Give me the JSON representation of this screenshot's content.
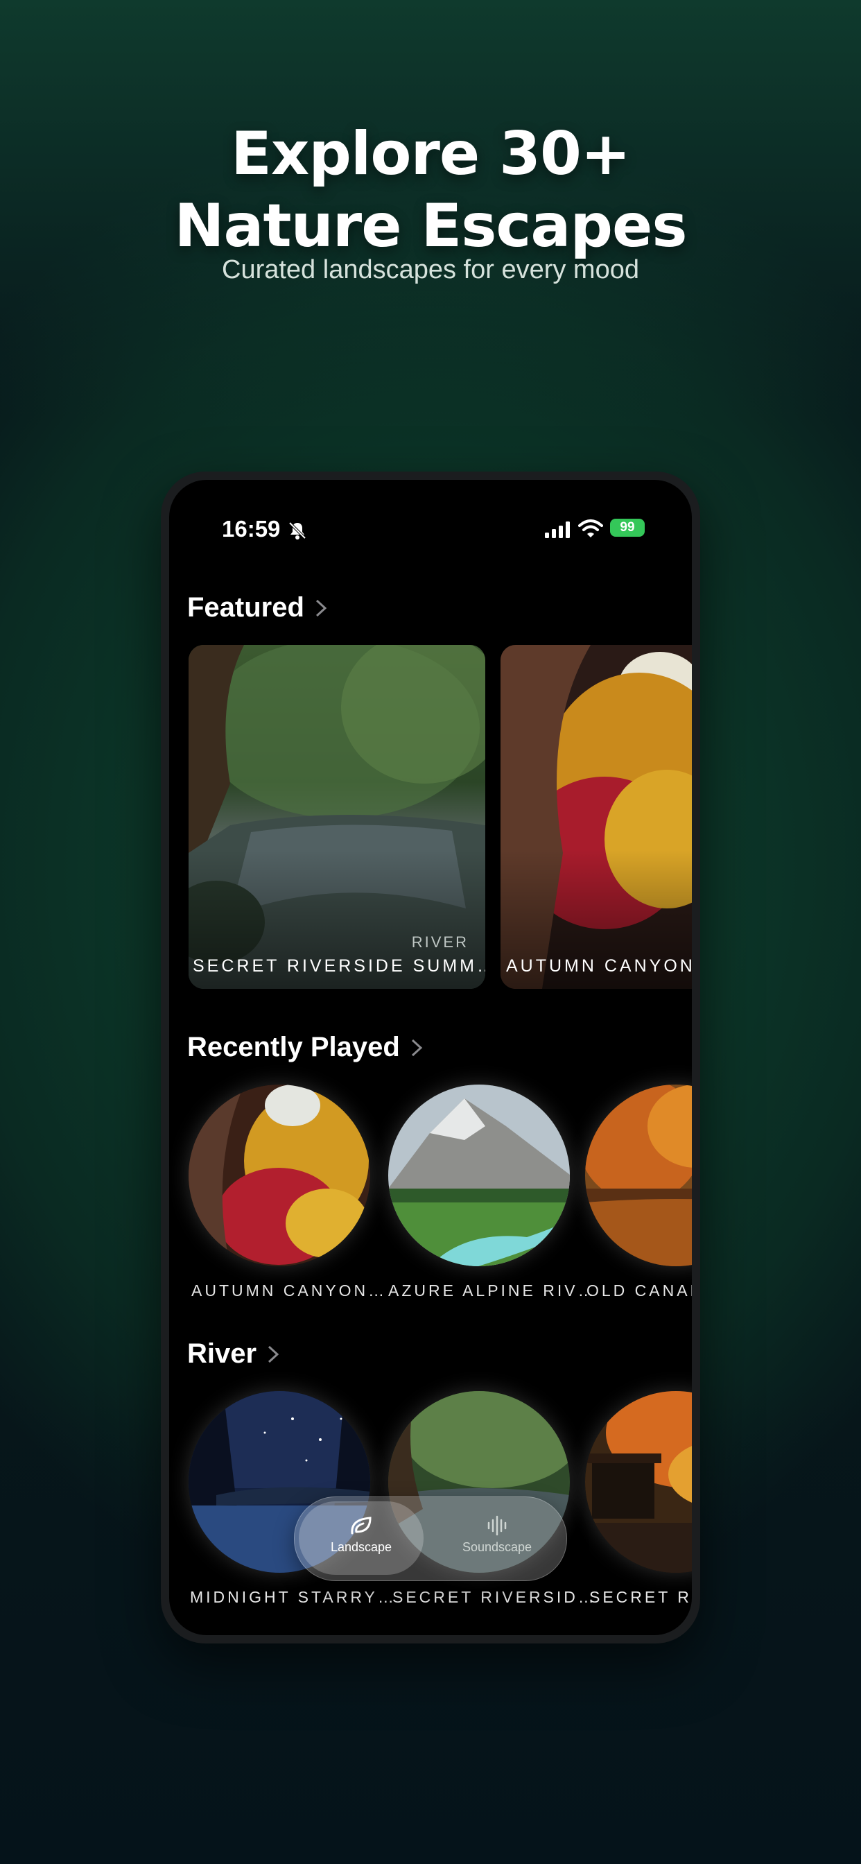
{
  "promo": {
    "headline_line1": "Explore 30+",
    "headline_line2": "Nature Escapes",
    "subheadline": "Curated landscapes for every mood"
  },
  "status_bar": {
    "time": "16:59",
    "battery": "99"
  },
  "sections": {
    "featured": {
      "title": "Featured",
      "cards": [
        {
          "category": "RIVER",
          "title": "SECRET RIVERSIDE SUMM…"
        },
        {
          "category": "",
          "title": "AUTUMN CANYON"
        }
      ]
    },
    "recently_played": {
      "title": "Recently Played",
      "items": [
        {
          "title": "AUTUMN CANYON…"
        },
        {
          "title": "AZURE ALPINE RIV…"
        },
        {
          "title": "OLD CANAL"
        }
      ]
    },
    "river": {
      "title": "River",
      "items": [
        {
          "title": "MIDNIGHT STARRY…"
        },
        {
          "title": "SECRET RIVERSID…"
        },
        {
          "title": "SECRET RIV"
        }
      ]
    }
  },
  "tab_bar": {
    "tabs": [
      {
        "label": "Landscape",
        "icon": "leaf-icon",
        "active": true
      },
      {
        "label": "Soundscape",
        "icon": "waveform-icon",
        "active": false
      }
    ]
  },
  "colors": {
    "background_top": "#0f3a2d",
    "background_bottom": "#05131a",
    "battery_green": "#34c759",
    "screen_bg": "#000000"
  }
}
